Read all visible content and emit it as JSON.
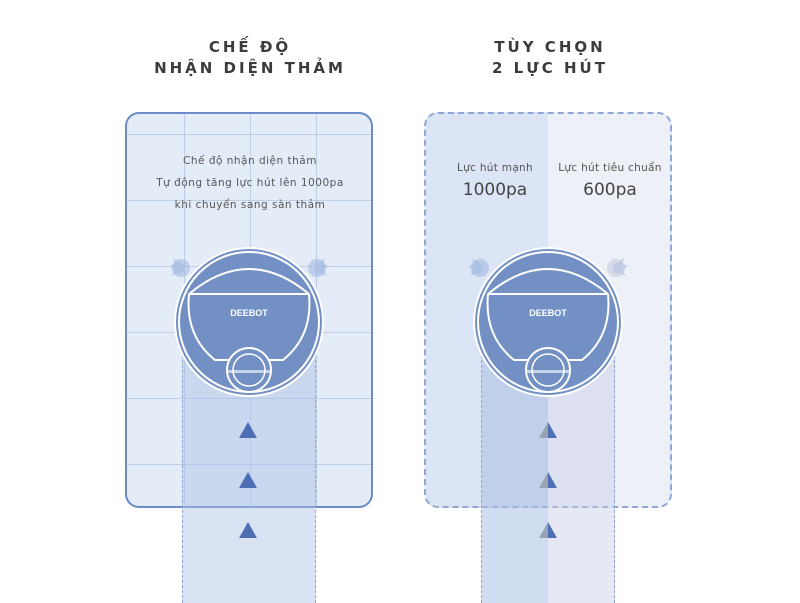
{
  "left": {
    "heading_line1": "CHẾ ĐỘ",
    "heading_line2": "NHẬN DIỆN THẢM",
    "desc_line1": "Chế độ nhận diện thảm",
    "desc_line2": "Tự động tăng lực hút lên 1000pa",
    "desc_line3": "khi chuyển sang sàn thảm",
    "robot_brand": "DEEBOT"
  },
  "right": {
    "heading_line1": "TÙY CHỌN",
    "heading_line2": "2 LỰC HÚT",
    "strong_label": "Lực hút mạnh",
    "strong_value": "1000pa",
    "standard_label": "Lực hút tiêu chuẩn",
    "standard_value": "600pa",
    "robot_brand": "DEEBOT"
  },
  "colors": {
    "robot_body": "#7390c4",
    "robot_outline": "#ffffff",
    "arrow_blue": "#4e6fb3",
    "arrow_gray": "#9aa3b3",
    "panel_border": "#6a8cc7"
  }
}
